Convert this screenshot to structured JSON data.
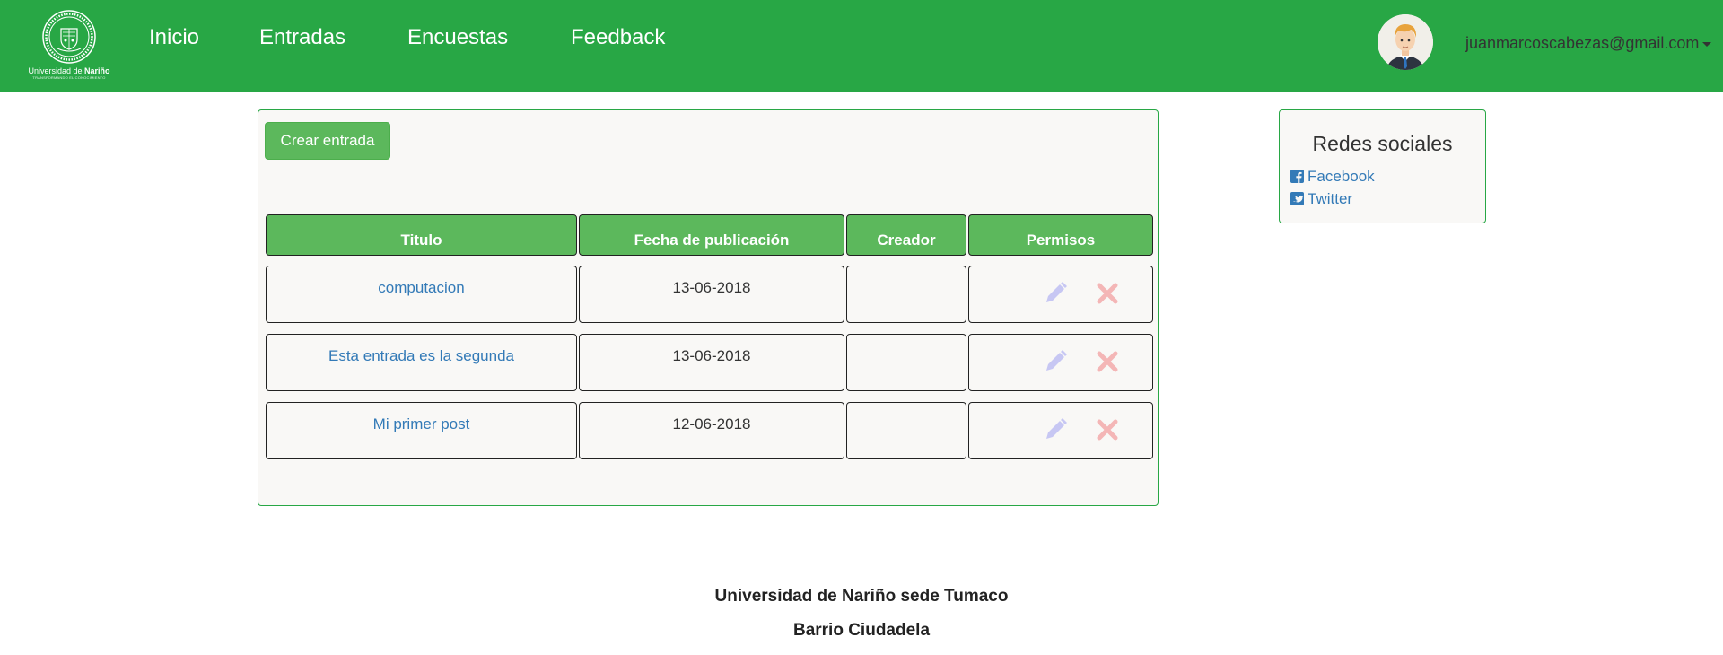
{
  "navbar": {
    "logo": {
      "line1": "Universidad de",
      "line1_bold": "Nariño",
      "subtitle": "TRANSFORMANDO EL CONOCIMIENTO"
    },
    "links": [
      "Inicio",
      "Entradas",
      "Encuestas",
      "Feedback"
    ],
    "user_email": "juanmarcoscabezas@gmail.com"
  },
  "entries": {
    "create_button": "Crear entrada",
    "columns": [
      "Titulo",
      "Fecha de publicación",
      "Creador",
      "Permisos"
    ],
    "rows": [
      {
        "title": "computacion",
        "date": "13-06-2018",
        "creator": ""
      },
      {
        "title": "Esta entrada es la segunda",
        "date": "13-06-2018",
        "creator": ""
      },
      {
        "title": "Mi primer post",
        "date": "12-06-2018",
        "creator": ""
      }
    ],
    "icons": {
      "edit": "pencil-icon",
      "delete": "close-icon"
    }
  },
  "sidebar": {
    "title": "Redes sociales",
    "links": [
      {
        "label": "Facebook",
        "icon": "facebook-icon"
      },
      {
        "label": "Twitter",
        "icon": "twitter-icon"
      }
    ]
  },
  "footer": {
    "line1": "Universidad de Nariño sede Tumaco",
    "line2": "Barrio Ciudadela"
  },
  "colors": {
    "navbar": "#28a745",
    "button": "#5cb85c",
    "link": "#337ab7",
    "edit_icon": "#c7c7f3",
    "delete_icon": "#f4b6b6"
  }
}
